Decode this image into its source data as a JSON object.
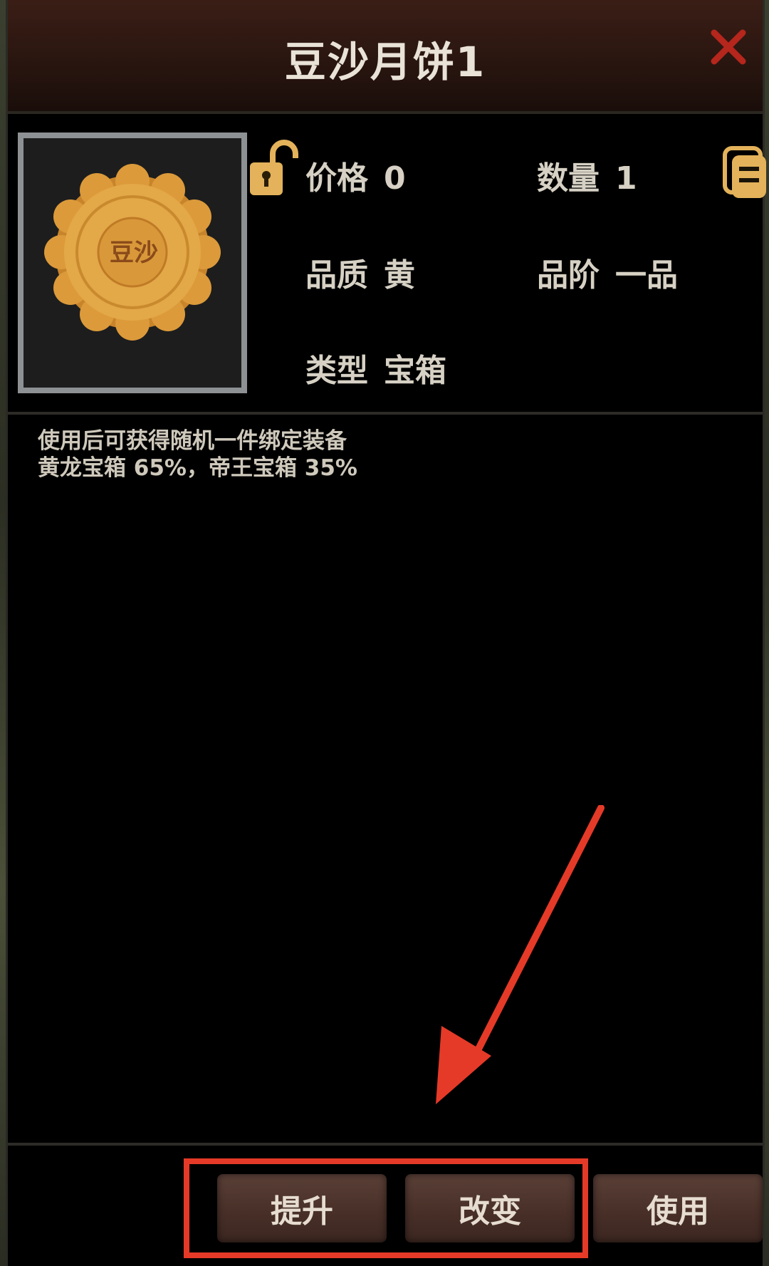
{
  "dialog": {
    "title": "豆沙月饼1",
    "close_label": "X"
  },
  "item": {
    "image_alt_text": "豆沙",
    "icon": "mooncake-icon"
  },
  "attributes": {
    "price": {
      "label": "价格",
      "value": "0"
    },
    "quantity": {
      "label": "数量",
      "value": "1"
    },
    "quality": {
      "label": "品质",
      "value": "黄"
    },
    "grade": {
      "label": "品阶",
      "value": "一品"
    },
    "type": {
      "label": "类型",
      "value": "宝箱"
    }
  },
  "description": {
    "line1": "使用后可获得随机一件绑定装备",
    "line2": "黄龙宝箱 65%，帝王宝箱 35%"
  },
  "buttons": {
    "upgrade": "提升",
    "change": "改变",
    "use": "使用"
  },
  "colors": {
    "accent_red": "#e53a28",
    "gold": "#e3b25a",
    "title_bar": "#2d1711"
  }
}
